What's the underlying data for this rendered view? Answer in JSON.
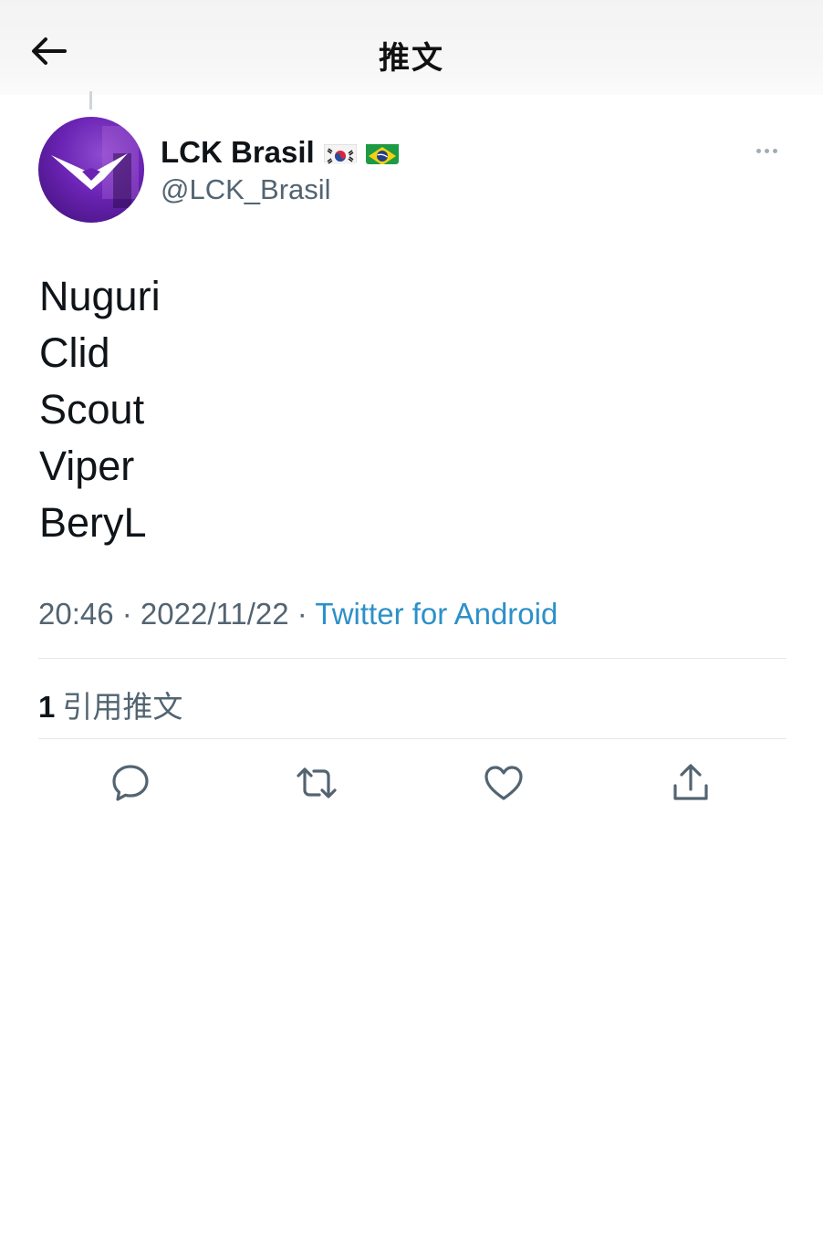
{
  "header": {
    "title": "推文",
    "back_icon": "arrow-left-icon"
  },
  "author": {
    "display_name": "LCK Brasil",
    "flags": [
      "south-korea-flag-icon",
      "brazil-flag-icon"
    ],
    "handle": "@LCK_Brasil",
    "avatar": "avatar",
    "avatar_color": "#6a23b3"
  },
  "tweet": {
    "lines": [
      "Nuguri",
      "Clid",
      "Scout",
      "Viper",
      "BeryL"
    ]
  },
  "meta": {
    "time": "20:46",
    "separator1": " · ",
    "date": "2022/11/22",
    "separator2": " · ",
    "source": "Twitter for Android",
    "source_color": "#2d90c8"
  },
  "stats": {
    "quote_count": "1",
    "quote_label": "引用推文"
  },
  "actions": [
    "reply-icon",
    "retweet-icon",
    "like-icon",
    "share-icon"
  ],
  "colors": {
    "text": "#0f1419",
    "secondary": "#536471",
    "divider": "#e4e8eb"
  }
}
